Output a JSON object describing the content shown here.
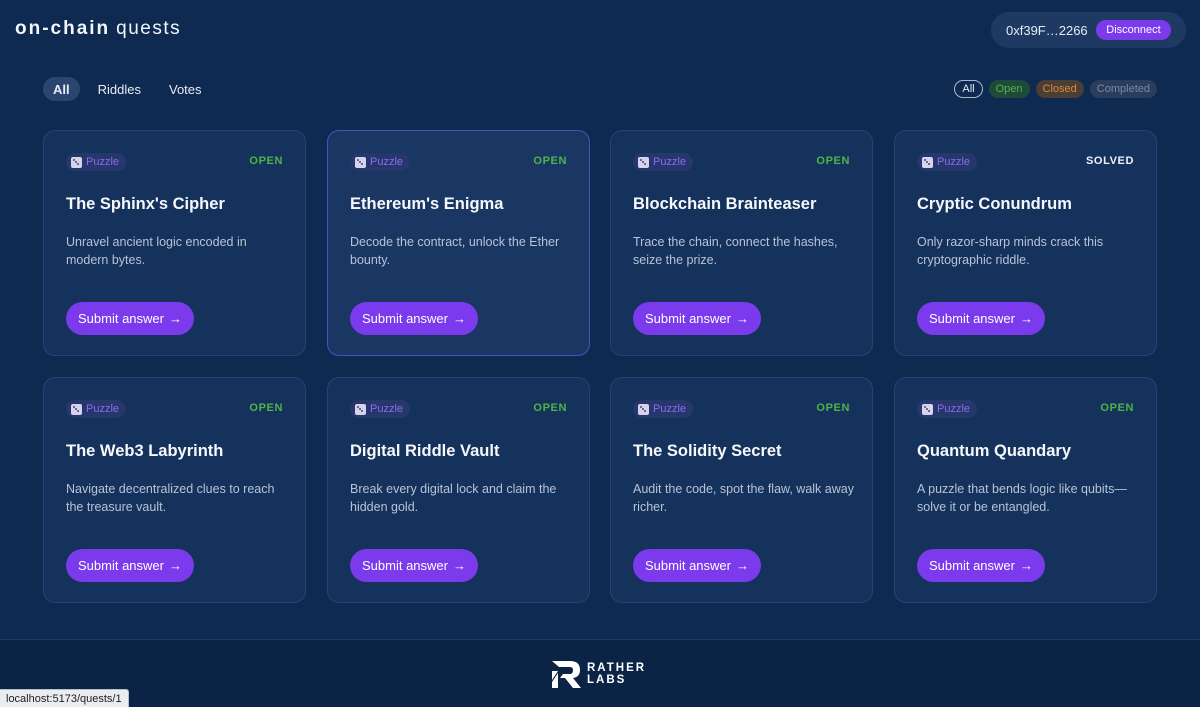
{
  "header": {
    "brand_bold": "on-chain",
    "brand_light": "quests",
    "wallet_address": "0xf39F…2266",
    "disconnect_label": "Disconnect"
  },
  "tabs": [
    {
      "label": "All",
      "active": true
    },
    {
      "label": "Riddles",
      "active": false
    },
    {
      "label": "Votes",
      "active": false
    }
  ],
  "filters": [
    {
      "label": "All"
    },
    {
      "label": "Open"
    },
    {
      "label": "Closed"
    },
    {
      "label": "Completed"
    }
  ],
  "cards": [
    {
      "category": "Puzzle",
      "status": "OPEN",
      "title": "The Sphinx's Cipher",
      "description": "Unravel ancient logic encoded in modern bytes.",
      "button": "Submit answer"
    },
    {
      "category": "Puzzle",
      "status": "OPEN",
      "title": "Ethereum's Enigma",
      "description": "Decode the contract, unlock the Ether bounty.",
      "button": "Submit answer"
    },
    {
      "category": "Puzzle",
      "status": "OPEN",
      "title": "Blockchain Brainteaser",
      "description": "Trace the chain, connect the hashes, seize the prize.",
      "button": "Submit answer"
    },
    {
      "category": "Puzzle",
      "status": "SOLVED",
      "title": "Cryptic Conundrum",
      "description": "Only razor-sharp minds crack this cryptographic riddle.",
      "button": "Submit answer"
    },
    {
      "category": "Puzzle",
      "status": "OPEN",
      "title": "The Web3 Labyrinth",
      "description": "Navigate decentralized clues to reach the treasure vault.",
      "button": "Submit answer"
    },
    {
      "category": "Puzzle",
      "status": "OPEN",
      "title": "Digital Riddle Vault",
      "description": "Break every digital lock and claim the hidden gold.",
      "button": "Submit answer"
    },
    {
      "category": "Puzzle",
      "status": "OPEN",
      "title": "The Solidity Secret",
      "description": "Audit the code, spot the flaw, walk away richer.",
      "button": "Submit answer"
    },
    {
      "category": "Puzzle",
      "status": "OPEN",
      "title": "Quantum Quandary",
      "description": "A puzzle that bends logic like qubits—solve it or be entangled.",
      "button": "Submit answer"
    }
  ],
  "footer": {
    "logo_line1": "RATHER",
    "logo_line2": "LABS"
  },
  "statusbar": {
    "url": "localhost:5173/quests/1"
  },
  "colors": {
    "background": "#0e2a50",
    "accent": "#7c3aed",
    "open": "#4fb34a",
    "closed": "#d9883f"
  }
}
